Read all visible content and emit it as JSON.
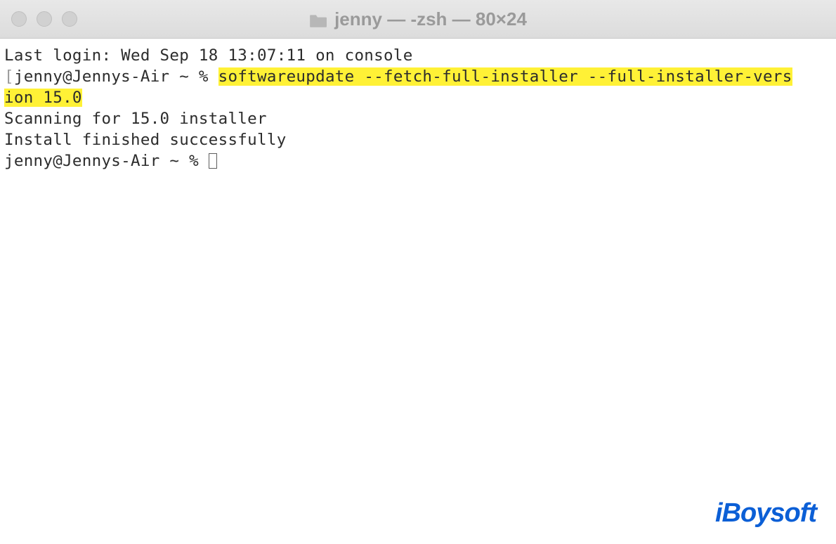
{
  "titlebar": {
    "title": "jenny — -zsh — 80×24"
  },
  "terminal": {
    "last_login": "Last login: Wed Sep 18 13:07:11 on console",
    "prompt_bracket_open": "[",
    "prompt1_user": "jenny@Jennys-Air ~ % ",
    "highlighted_cmd_part1": "softwareupdate --fetch-full-installer --full-installer-vers",
    "highlighted_cmd_part2": "ion 15.0",
    "output_line1": "Scanning for 15.0 installer",
    "output_line2": "Install finished successfully",
    "prompt2_user": "jenny@Jennys-Air ~ % "
  },
  "watermark": {
    "text": "iBoysoft"
  }
}
